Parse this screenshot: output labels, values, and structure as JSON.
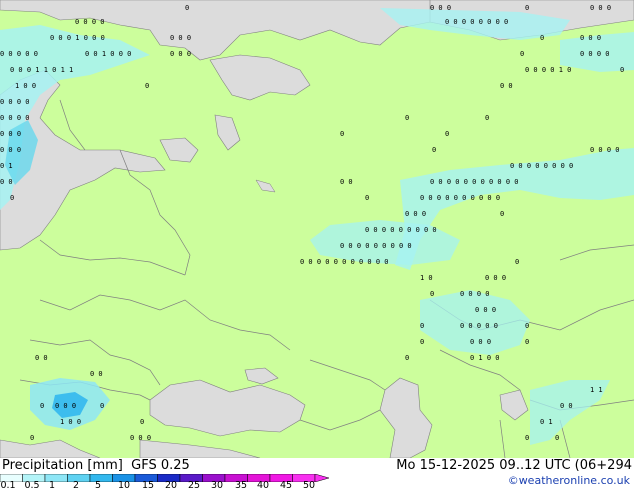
{
  "title": {
    "product": "Precipitation [mm]",
    "model": "GFS 0.25",
    "datetime": "Mo 15-12-2025 09..12 UTC (06+294",
    "credit": "©weatheronline.co.uk"
  },
  "legend": {
    "labels": [
      "0.1",
      "0.5",
      "1",
      "2",
      "5",
      "10",
      "15",
      "20",
      "25",
      "30",
      "35",
      "40",
      "45",
      "50"
    ],
    "colors": [
      "#e8fefe",
      "#b4f4f8",
      "#8ee6f6",
      "#5fd2f2",
      "#33b8ee",
      "#1a92e6",
      "#1a5ad8",
      "#1a2ac6",
      "#5a1ac8",
      "#9a10cc",
      "#c810d2",
      "#e414d8",
      "#f018e4",
      "#f830f0"
    ]
  },
  "colors": {
    "land": "#ccfe9c",
    "sea": "#dcdcdc",
    "border": "#808080",
    "precip_light": "#a6f2f2",
    "precip_medium": "#66d8ee",
    "precip_heavy": "#33a8e8"
  },
  "precip_markers": [
    "0",
    "1",
    "0",
    "0",
    "1",
    "0",
    "0",
    "1",
    "0",
    "1"
  ]
}
